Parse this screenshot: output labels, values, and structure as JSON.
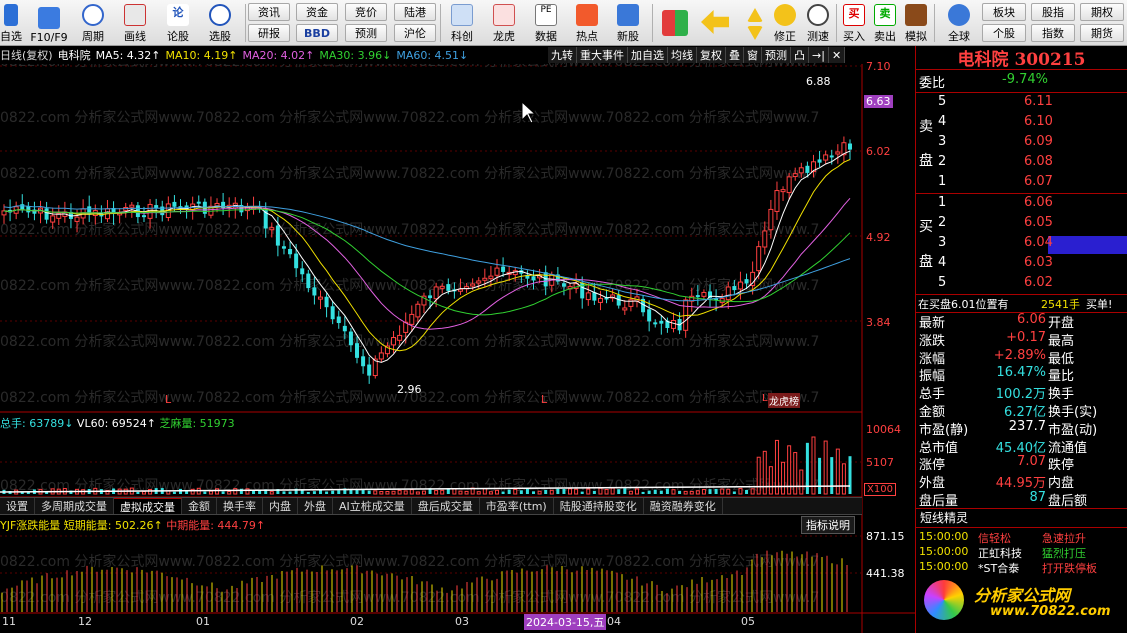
{
  "toolbar": {
    "items": [
      {
        "label": "自选"
      },
      {
        "label": "F10/F9"
      },
      {
        "label": "周期"
      },
      {
        "label": "画线"
      },
      {
        "label": "论股"
      },
      {
        "label": "选股"
      }
    ],
    "small_buttons_top": [
      "资讯",
      "资金",
      "竞价",
      "陆港"
    ],
    "small_buttons_bottom": [
      "研报",
      "BBD",
      "预测",
      "沪伦"
    ],
    "icon_items": [
      {
        "label": "科创"
      },
      {
        "label": "龙虎"
      },
      {
        "label": "数据"
      },
      {
        "label": "热点"
      },
      {
        "label": "新股"
      }
    ],
    "nav_items": [
      {
        "label": "修正"
      },
      {
        "label": "测速"
      },
      {
        "label": "买入"
      },
      {
        "label": "卖出"
      },
      {
        "label": "模拟"
      },
      {
        "label": "全球"
      }
    ],
    "right_top": [
      "板块",
      "股指",
      "期权"
    ],
    "right_bottom": [
      "个股",
      "指数",
      "期货"
    ]
  },
  "chart_header": {
    "period": "日线(复权)",
    "name": "电科院",
    "ma5": "MA5: 4.32↑",
    "ma10": "MA10: 4.19↑",
    "ma20": "MA20: 4.02↑",
    "ma30": "MA30: 3.96↓",
    "ma60": "MA60: 4.51↓"
  },
  "chart_tools": [
    "九转",
    "重大事件",
    "加自选",
    "均线",
    "复权",
    "叠",
    "窗",
    "预测",
    "凸",
    "→|",
    "✕"
  ],
  "price_axis": [
    "7.10",
    "6.63",
    "6.02",
    "4.92",
    "3.84"
  ],
  "price_marks": {
    "high": "6.88",
    "low": "2.96",
    "l1": "L",
    "l2": "L",
    "l3": "L",
    "bang": "龙虎榜"
  },
  "watermark": "0822.com 分析家公式网www.70822.com 分析家公式网www.70822.com 分析家公式网www.70822.com 分析家公式网www.7",
  "volume": {
    "total": "总手: 63789↓",
    "vl60": "VL60: 69524↑",
    "zhima": "芝麻量: 51973",
    "axis": [
      "10064",
      "5107",
      "X100"
    ]
  },
  "tabs": [
    "设置",
    "多周期成交量",
    "虚拟成交量",
    "金额",
    "换手率",
    "内盘",
    "外盘",
    "AI立桩成交量",
    "盘后成交量",
    "市盈率(ttm)",
    "陆股通持股变化",
    "融资融券变化"
  ],
  "indicator": {
    "name": "YJF涨跌能量",
    "short": "短期能量: 502.26↑",
    "mid": "中期能量: 444.79↑",
    "button": "指标说明",
    "axis": [
      "871.15",
      "441.38"
    ]
  },
  "time_axis": [
    "11",
    "12",
    "01",
    "02",
    "03",
    "2024-03-15,五",
    "04",
    "05"
  ],
  "panel": {
    "code": "电科院 300215",
    "weibi_label": "委比",
    "weibi_value": "-9.74%",
    "sell_side": "卖",
    "sell_side2": "盘",
    "buy_side": "买",
    "buy_side2": "盘",
    "asks": [
      {
        "lvl": "5",
        "price": "6.11"
      },
      {
        "lvl": "4",
        "price": "6.10"
      },
      {
        "lvl": "3",
        "price": "6.09"
      },
      {
        "lvl": "2",
        "price": "6.08"
      },
      {
        "lvl": "1",
        "price": "6.07"
      }
    ],
    "bids": [
      {
        "lvl": "1",
        "price": "6.06"
      },
      {
        "lvl": "2",
        "price": "6.05"
      },
      {
        "lvl": "3",
        "price": "6.04"
      },
      {
        "lvl": "4",
        "price": "6.03"
      },
      {
        "lvl": "5",
        "price": "6.02"
      }
    ],
    "note_prefix": "在买盘6.01位置有",
    "note_qty": "2541手",
    "note_suffix": "买单!",
    "stats": [
      {
        "l": "最新",
        "v": "6.06",
        "c": "red",
        "r": "开盘"
      },
      {
        "l": "涨跌",
        "v": "+0.17",
        "c": "red",
        "r": "最高"
      },
      {
        "l": "涨幅",
        "v": "+2.89%",
        "c": "red",
        "r": "最低"
      },
      {
        "l": "振幅",
        "v": "16.47%",
        "c": "cyan",
        "r": "量比"
      },
      {
        "l": "总手",
        "v": "100.2万",
        "c": "cyan",
        "r": "换手"
      },
      {
        "l": "金额",
        "v": "6.27亿",
        "c": "cyan",
        "r": "换手(实)"
      },
      {
        "l": "市盈(静)",
        "v": "237.7",
        "c": "white",
        "r": "市盈(动)"
      },
      {
        "l": "总市值",
        "v": "45.40亿",
        "c": "cyan",
        "r": "流通值"
      },
      {
        "l": "涨停",
        "v": "7.07",
        "c": "red",
        "r": "跌停"
      },
      {
        "l": "外盘",
        "v": "44.95万",
        "c": "red",
        "r": "内盘"
      },
      {
        "l": "盘后量",
        "v": "87",
        "c": "cyan",
        "r": "盘后额"
      }
    ],
    "sprite_title": "短线精灵",
    "sprite": [
      {
        "time": "15:00:00",
        "name": "信轻松",
        "event": "急速拉升"
      },
      {
        "time": "15:00:00",
        "name": "正虹科技",
        "event": "猛烈打压"
      },
      {
        "time": "15:00:00",
        "name": "*ST合泰",
        "event": "打开跌停板"
      }
    ],
    "logo_text": "分析家公式网",
    "logo_url": "www.70822.com"
  },
  "colors": {
    "up": "#ff4040",
    "down": "#34e0e0",
    "ma5": "#ffffff",
    "ma10": "#f0e000",
    "ma20": "#e060e0",
    "ma30": "#31d131",
    "ma60": "#3fa0e0"
  }
}
